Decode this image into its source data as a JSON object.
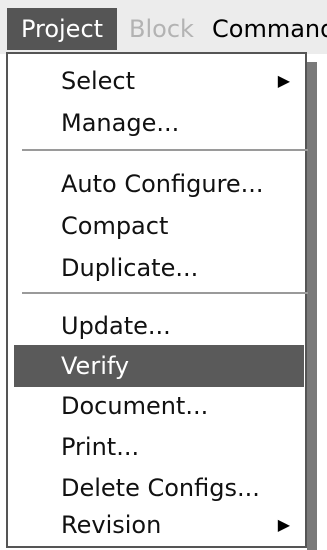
{
  "menubar": {
    "items": [
      {
        "label": "Project",
        "state": "active"
      },
      {
        "label": "Block",
        "state": "disabled"
      },
      {
        "label": "Command",
        "state": "normal"
      }
    ]
  },
  "menu": {
    "groups": [
      [
        {
          "label": "Select",
          "submenu_indicator": "▶"
        },
        {
          "label": "Manage..."
        }
      ],
      [
        {
          "label": "Auto Configure..."
        },
        {
          "label": "Compact"
        },
        {
          "label": "Duplicate..."
        }
      ],
      [
        {
          "label": "Update..."
        },
        {
          "label": "Verify",
          "highlighted": true
        },
        {
          "label": "Document..."
        },
        {
          "label": "Print..."
        },
        {
          "label": "Delete Configs..."
        },
        {
          "label": "Revision",
          "submenu_indicator": "▶"
        }
      ]
    ]
  },
  "colors": {
    "menubar_bg": "#ececec",
    "active_bg": "#555555",
    "highlight_bg": "#5a5a5a",
    "disabled_text": "#b3b3b3",
    "separator": "#9a9a9a"
  },
  "icons": {
    "submenu": "triangle-right-icon"
  }
}
